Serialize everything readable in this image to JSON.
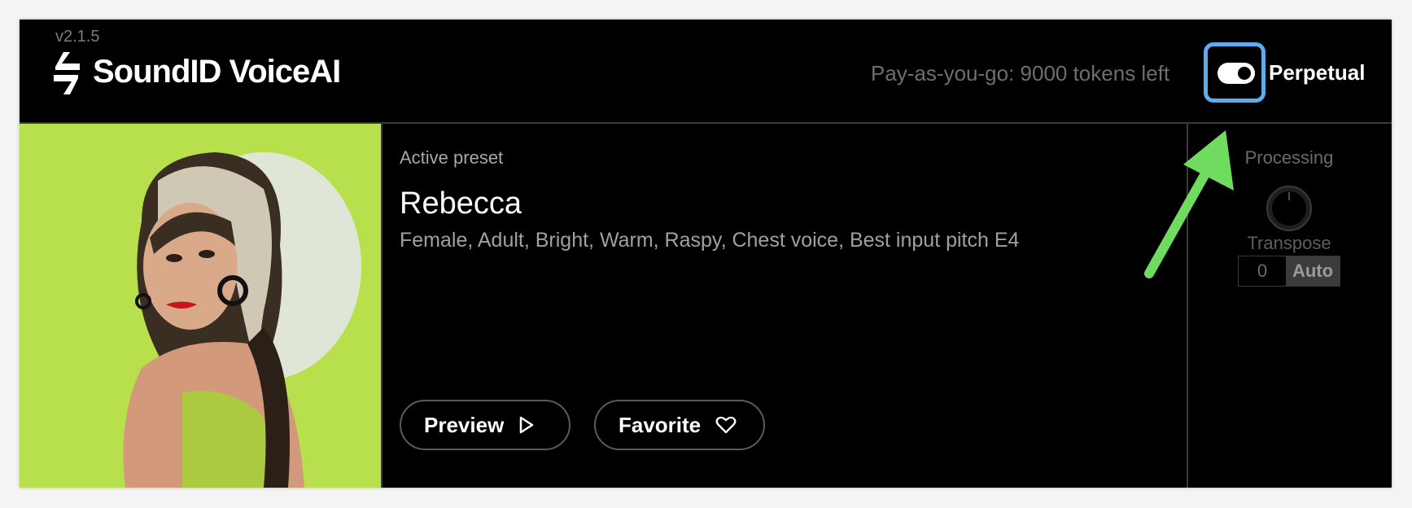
{
  "header": {
    "version": "v2.1.5",
    "app_name": "SoundID VoiceAI",
    "tokens_text": "Pay-as-you-go: 9000 tokens left",
    "toggle_label": "Perpetual"
  },
  "preset": {
    "label": "Active preset",
    "name": "Rebecca",
    "tags": "Female, Adult, Bright, Warm, Raspy, Chest voice, Best input pitch  E4"
  },
  "buttons": {
    "preview": "Preview",
    "favorite": "Favorite"
  },
  "processing": {
    "label": "Processing",
    "transpose_label": "Transpose",
    "transpose_value": "0",
    "auto_label": "Auto"
  },
  "colors": {
    "accent_highlight": "#5aaef0",
    "arrow": "#6fdc5f",
    "photo_bg": "#b8e04c"
  }
}
